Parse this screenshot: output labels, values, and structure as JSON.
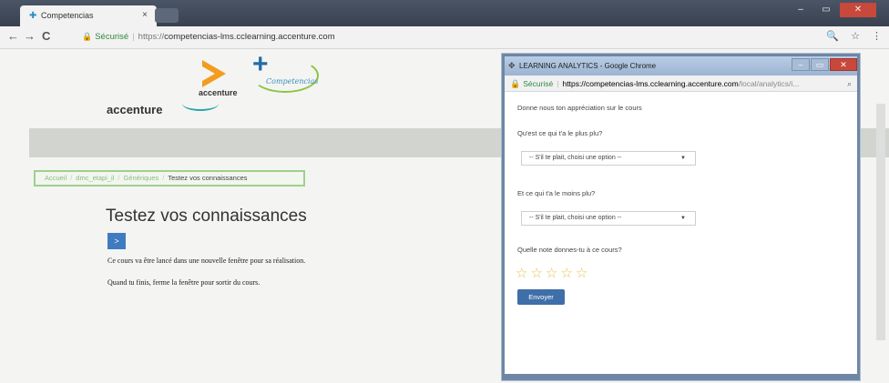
{
  "browser": {
    "tab_title": "Competencias",
    "tab_close": "×",
    "address_secure_label": "Sécurisé",
    "address_scheme": "https://",
    "address_host": "competencias-lms.cclearning.accenture.com",
    "window_controls": {
      "minimize": "–",
      "maximize": "▭",
      "close": "✕"
    },
    "nav": {
      "back": "←",
      "forward": "→",
      "reload": "C"
    },
    "toolbar_icons": {
      "search": "🔍",
      "star": "☆",
      "menu": "⋮"
    }
  },
  "logo": {
    "small_text": "accenture",
    "competencias_text": "Competencias",
    "brand_text": "accenture"
  },
  "breadcrumb": {
    "items": [
      "Accueil",
      "dmc_etapi_il",
      "Génériques"
    ],
    "current": "Testez vos connaissances",
    "separator": "/"
  },
  "main": {
    "title": "Testez vos connaissances",
    "launch_button": ">",
    "paragraph1": "Ce cours va être lancé dans une nouvelle fenêtre pour sa réalisation.",
    "paragraph2": "Quand tu finis, ferme la fenêtre pour sortir du cours."
  },
  "popup": {
    "window_title": "LEARNING ANALYTICS - Google Chrome",
    "address_secure_label": "Sécurisé",
    "address_host": "https://competencias-lms.cclearning.accenture.com",
    "address_path": "/local/analytics/i...",
    "intro": "Donne nous ton appréciation sur le cours",
    "q1_label": "Qu'est ce qui t'a le plus plu?",
    "q1_select": "-- S'il te plait, choisi une option --",
    "q2_label": "Et ce qui t'a le moins plu?",
    "q2_select": "-- S'il te plait, choisi une option --",
    "q3_label": "Quelle note donnes-tu à ce cours?",
    "stars": [
      "☆",
      "☆",
      "☆",
      "☆",
      "☆"
    ],
    "submit": "Envoyer"
  }
}
